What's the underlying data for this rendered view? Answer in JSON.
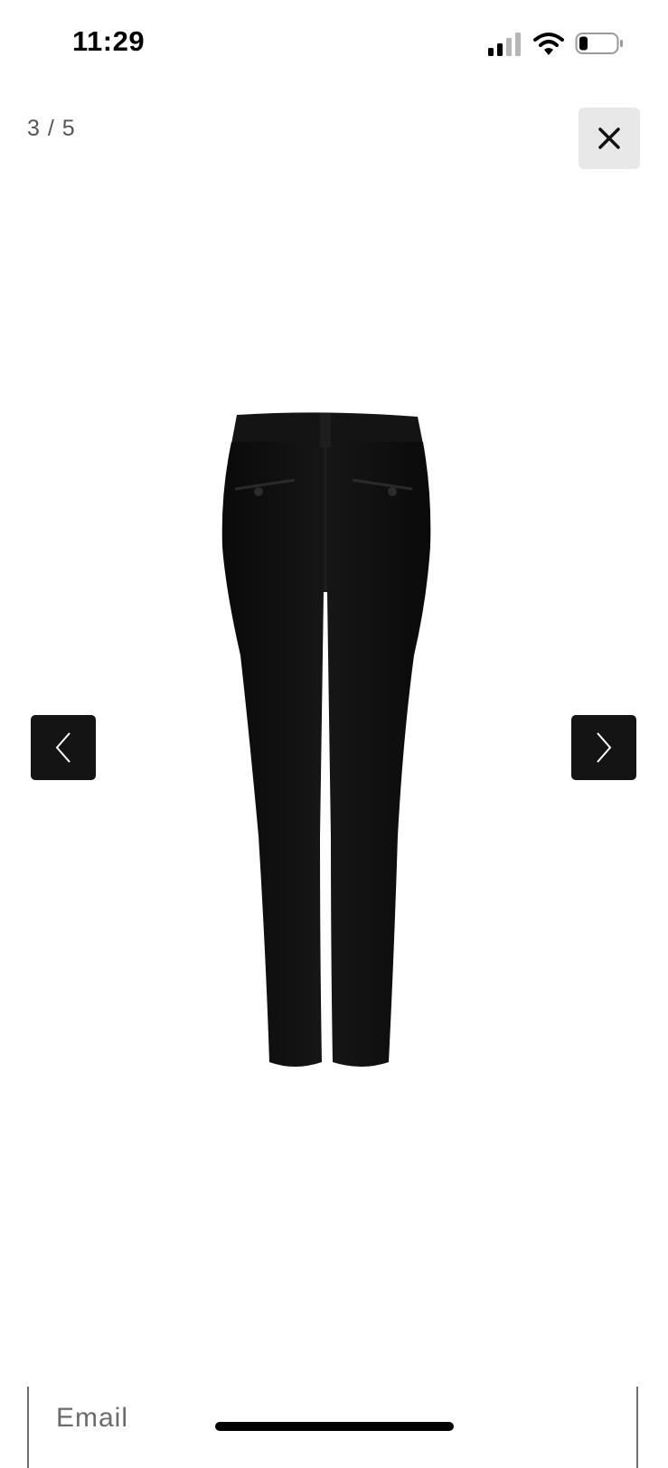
{
  "status_bar": {
    "time": "11:29"
  },
  "gallery": {
    "counter": "3 / 5",
    "close_icon": "close-icon",
    "prev_icon": "chevron-left-icon",
    "next_icon": "chevron-right-icon",
    "image": "black trousers back view"
  },
  "form": {
    "email_placeholder": "Email"
  },
  "colors": {
    "nav_button_bg": "#141414",
    "close_button_bg": "#e8e8e8",
    "counter_text": "#555555"
  }
}
